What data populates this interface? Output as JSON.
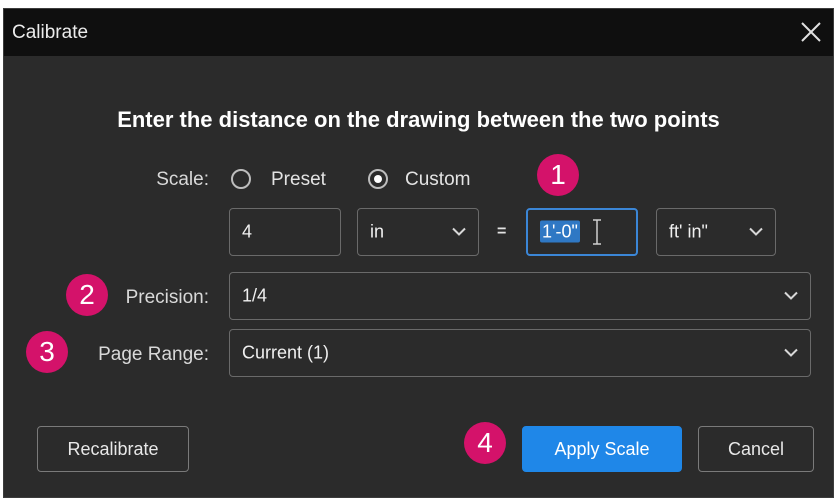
{
  "dialog": {
    "title": "Calibrate",
    "close_icon": "close-icon",
    "heading": "Enter the distance on the drawing between the two points"
  },
  "scale": {
    "label": "Scale:",
    "options": [
      "Preset",
      "Custom"
    ],
    "selected": "Custom",
    "drawing_value": "4",
    "drawing_unit": "in",
    "equals": "=",
    "real_value": "1'-0\"",
    "real_unit": "ft' in\""
  },
  "precision": {
    "label": "Precision:",
    "value": "1/4"
  },
  "page_range": {
    "label": "Page Range:",
    "value": "Current (1)"
  },
  "buttons": {
    "recalibrate": "Recalibrate",
    "apply": "Apply Scale",
    "cancel": "Cancel"
  },
  "callouts": [
    "1",
    "2",
    "3",
    "4"
  ],
  "colors": {
    "dialog_bg": "#2b2b2b",
    "titlebar_bg": "#0f0f0f",
    "accent": "#1f87e8",
    "callout": "#d4126a",
    "focus_border": "#3b86d6"
  }
}
